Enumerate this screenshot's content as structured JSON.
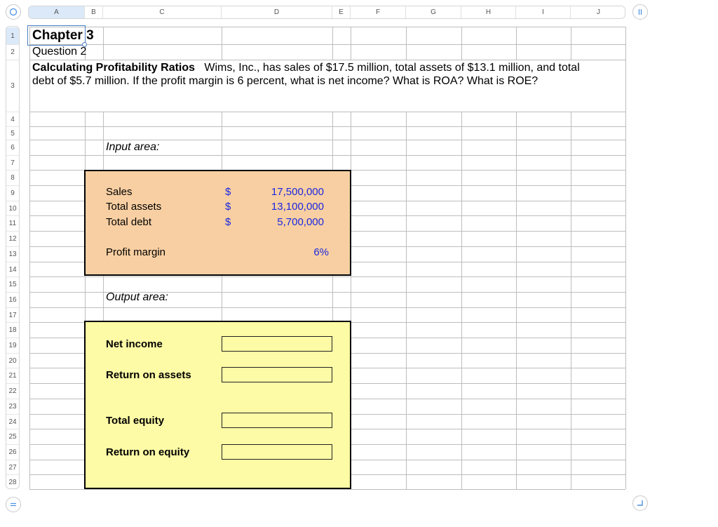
{
  "columns": [
    "A",
    "B",
    "C",
    "D",
    "E",
    "F",
    "G",
    "H",
    "I",
    "J"
  ],
  "rows": [
    "1",
    "2",
    "3",
    "4",
    "5",
    "6",
    "7",
    "8",
    "9",
    "10",
    "11",
    "12",
    "13",
    "14",
    "15",
    "16",
    "17",
    "18",
    "19",
    "20",
    "21",
    "22",
    "23",
    "24",
    "25",
    "26",
    "27",
    "28"
  ],
  "selected_cell": "A1",
  "sheet": {
    "chapter": "Chapter 3",
    "question": "Question 2",
    "problem_title": "Calculating Profitability Ratios",
    "problem_line1": "Wims, Inc., has sales of $17.5 million, total assets of $13.1 million, and total",
    "problem_line2": "debt of $5.7 million. If the profit margin is 6 percent, what is net income? What is ROA? What is ROE?",
    "input_label": "Input area:",
    "output_label": "Output area:"
  },
  "inputs": {
    "items": [
      {
        "label": "Sales",
        "currency": "$",
        "value": "17,500,000"
      },
      {
        "label": "Total assets",
        "currency": "$",
        "value": "13,100,000"
      },
      {
        "label": "Total debt",
        "currency": "$",
        "value": "5,700,000"
      }
    ],
    "profit_margin": {
      "label": "Profit margin",
      "value": "6%"
    }
  },
  "outputs": [
    {
      "label": "Net income",
      "value": ""
    },
    {
      "label": "Return on assets",
      "value": ""
    },
    {
      "label": "Total equity",
      "value": ""
    },
    {
      "label": "Return on equity",
      "value": ""
    }
  ],
  "colors": {
    "input_fill": "#f8cfa2",
    "output_fill": "#fefba6",
    "input_value_color": "#1b27e0",
    "selection_color": "#4a7fc1",
    "accent_blue": "#4a90e2"
  }
}
